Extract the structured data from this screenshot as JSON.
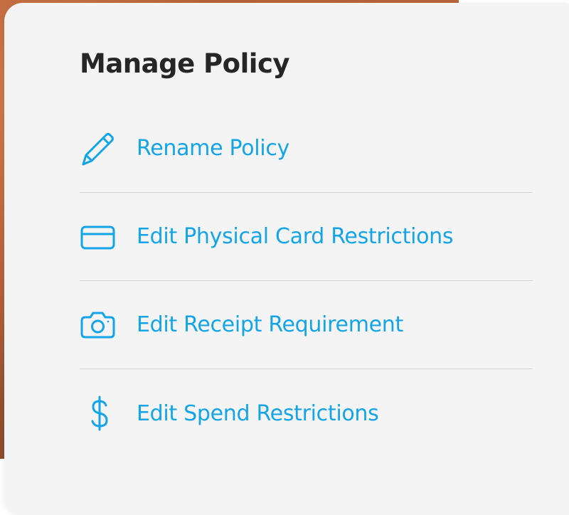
{
  "panel": {
    "title": "Manage Policy"
  },
  "menu": {
    "items": [
      {
        "label": "Rename Policy",
        "icon": "pencil-icon"
      },
      {
        "label": "Edit Physical Card Restrictions",
        "icon": "credit-card-icon"
      },
      {
        "label": "Edit Receipt Requirement",
        "icon": "camera-icon"
      },
      {
        "label": "Edit Spend Restrictions",
        "icon": "dollar-sign-icon"
      }
    ]
  },
  "colors": {
    "accent": "#14a4e8",
    "title": "#262626",
    "panel_background": "#f4f4f4",
    "divider": "#d4d4d4"
  }
}
